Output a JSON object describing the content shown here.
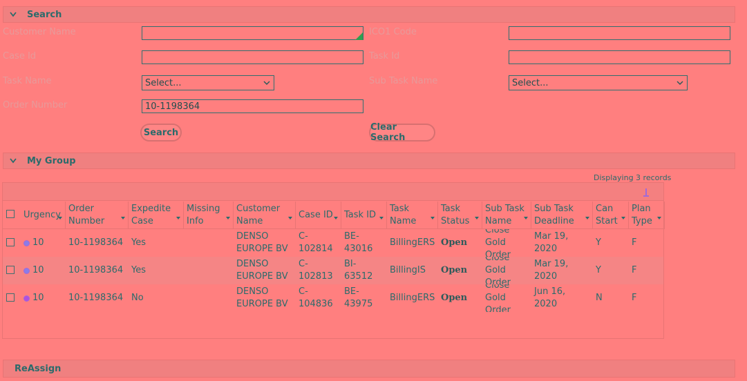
{
  "search_section": {
    "title": "Search",
    "fields": {
      "customer_name": {
        "label": "Customer Name",
        "value": ""
      },
      "ico1_code": {
        "label": "ICO1 Code",
        "value": ""
      },
      "case_id": {
        "label": "Case Id",
        "value": ""
      },
      "task_id": {
        "label": "Task Id",
        "value": ""
      },
      "task_name": {
        "label": "Task Name",
        "selected": "Select..."
      },
      "sub_task_name": {
        "label": "Sub Task Name",
        "selected": "Select..."
      },
      "order_number": {
        "label": "Order Number",
        "value": "10-1198364"
      }
    },
    "search_button": "Search",
    "clear_button": "Clear Search"
  },
  "my_group": {
    "title": "My Group",
    "records_text": "Displaying 3 records",
    "columns": [
      {
        "key": "urgency",
        "l1": "Urgency",
        "l2": ""
      },
      {
        "key": "order_number",
        "l1": "Order",
        "l2": "Number"
      },
      {
        "key": "expedite_case",
        "l1": "Expedite",
        "l2": "Case"
      },
      {
        "key": "missing_info",
        "l1": "Missing",
        "l2": "Info"
      },
      {
        "key": "customer_name",
        "l1": "Customer",
        "l2": "Name"
      },
      {
        "key": "case_id",
        "l1": "Case ID",
        "l2": ""
      },
      {
        "key": "task_id",
        "l1": "Task ID",
        "l2": ""
      },
      {
        "key": "task_name",
        "l1": "Task",
        "l2": "Name"
      },
      {
        "key": "task_status",
        "l1": "Task",
        "l2": "Status"
      },
      {
        "key": "sub_task_name",
        "l1": "Sub Task",
        "l2": "Name"
      },
      {
        "key": "sub_task_deadline",
        "l1": "Sub Task",
        "l2": "Deadline"
      },
      {
        "key": "can_start",
        "l1": "Can",
        "l2": "Start"
      },
      {
        "key": "plan_type",
        "l1": "Plan",
        "l2": "Type"
      }
    ],
    "rows": [
      {
        "urgency": "10",
        "order_number": "10-1198364",
        "expedite_case": "Yes",
        "missing_info": "",
        "customer_l1": "DENSO",
        "customer_l2": "EUROPE BV",
        "case_id": "C-102814",
        "task_id": "BE-43016",
        "task_name": "BillingERS",
        "task_status": "Open",
        "sub_l1": "Close Gold",
        "sub_l2": "Order",
        "deadline": "Mar 19, 2020",
        "can_start": "Y",
        "plan_type": "F",
        "dot_color": "#8a7ce8"
      },
      {
        "urgency": "10",
        "order_number": "10-1198364",
        "expedite_case": "Yes",
        "missing_info": "",
        "customer_l1": "DENSO",
        "customer_l2": "EUROPE BV",
        "case_id": "C-102813",
        "task_id": "BI-63512",
        "task_name": "BillingIS",
        "task_status": "Open",
        "sub_l1": "Close Gold",
        "sub_l2": "Order",
        "deadline": "Mar 19, 2020",
        "can_start": "Y",
        "plan_type": "F",
        "dot_color": "#8a7ce8"
      },
      {
        "urgency": "10",
        "order_number": "10-1198364",
        "expedite_case": "No",
        "missing_info": "",
        "customer_l1": "DENSO",
        "customer_l2": "EUROPE BV",
        "case_id": "C-104836",
        "task_id": "BE-43975",
        "task_name": "BillingERS",
        "task_status": "Open",
        "sub_l1": "Close Gold",
        "sub_l2": "Order",
        "deadline": "Jun 16, 2020",
        "can_start": "N",
        "plan_type": "F",
        "dot_color": "#b050e0"
      }
    ]
  },
  "reassign_section": {
    "title": "ReAssign"
  },
  "icons": {
    "collapse": "chevron-down-icon",
    "sort": "sort-desc-icon",
    "urgency": "urgency-dot-icon"
  }
}
